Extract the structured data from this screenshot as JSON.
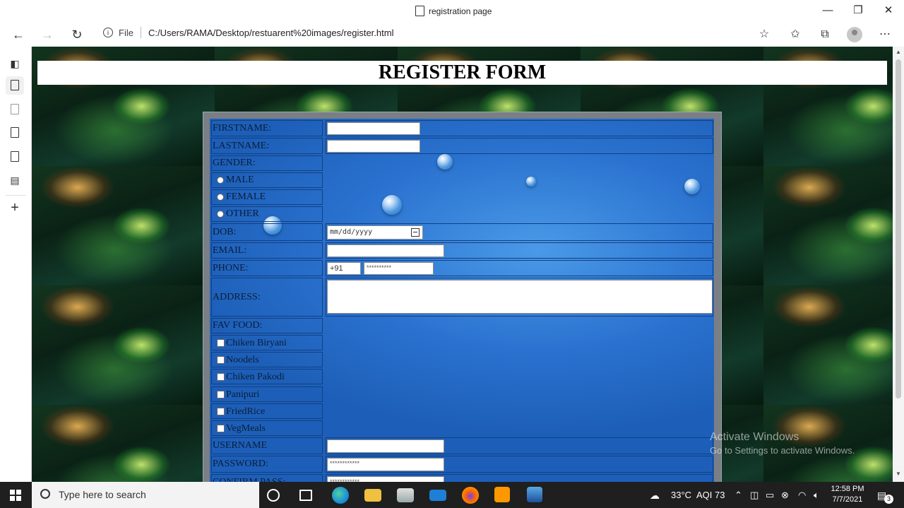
{
  "browser": {
    "tab_title": "registration page",
    "controls": {
      "minimize": "—",
      "maximize": "❐",
      "close": "✕"
    },
    "nav": {
      "back": "←",
      "forward": "→",
      "refresh": "↻"
    },
    "address": {
      "info": "i",
      "scheme": "File",
      "url": "C:/Users/RAMA/Desktop/restuarent%20images/register.html"
    },
    "toolbar_icons": [
      "☆",
      "✩",
      "⧉",
      "⋯"
    ]
  },
  "vertical_tabs": {
    "new_tab": "+"
  },
  "page": {
    "header": "REGISTER FORM",
    "form": {
      "firstname_label": "FIRSTNAME:",
      "lastname_label": "LASTNAME:",
      "gender_label": "GENDER:",
      "gender_options": [
        "MALE",
        "FEMALE",
        "OTHER"
      ],
      "dob_label": "DOB:",
      "dob_placeholder": "mm/dd/yyyy",
      "email_label": "EMAIL:",
      "phone_label": "PHONE:",
      "phone_code": "+91",
      "phone_placeholder": "**********",
      "address_label": "ADDRESS:",
      "favfood_label": "FAV FOOD:",
      "food_options": [
        "Chiken Biryani",
        "Noodels",
        "Chiken Pakodi",
        "Panipuri",
        "FriedRice",
        "VegMeals"
      ],
      "username_label": "USERNAME",
      "password_label": "PASSWORD:",
      "password_placeholder": "************",
      "confirm_label": "CONFIRM PASS:",
      "confirm_placeholder": "************"
    },
    "watermark": {
      "line1": "Activate Windows",
      "line2": "Go to Settings to activate Windows."
    }
  },
  "taskbar": {
    "search_placeholder": "Type here to search",
    "weather": "33°C",
    "aqi": "AQI 73",
    "time": "12:58 PM",
    "date": "7/7/2021",
    "notifications": "3"
  }
}
